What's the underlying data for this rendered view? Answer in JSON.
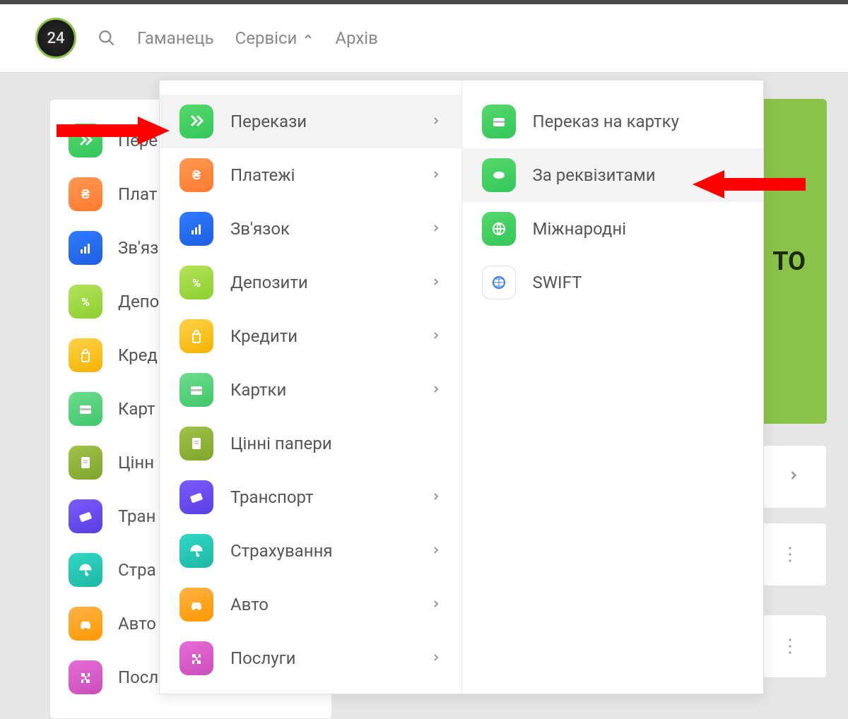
{
  "logo_text": "24",
  "header": {
    "nav_wallet": "Гаманець",
    "nav_services": "Сервіси",
    "nav_archive": "Архів"
  },
  "bg_sidebar": [
    "Пере",
    "Плат",
    "Зв'яз",
    "Депо",
    "Кред",
    "Карт",
    "Цінн",
    "Тран",
    "Стра",
    "Авто",
    "Посл"
  ],
  "bg_green_text": "ТО",
  "menu_left": [
    {
      "label": "Перекази",
      "icon": "chevrons",
      "color": "ic-green",
      "active": true,
      "chev": true
    },
    {
      "label": "Платежі",
      "icon": "uah",
      "color": "ic-orange",
      "active": false,
      "chev": true
    },
    {
      "label": "Зв'язок",
      "icon": "bars",
      "color": "ic-blue",
      "active": false,
      "chev": true
    },
    {
      "label": "Депозити",
      "icon": "percent",
      "color": "ic-lime",
      "active": false,
      "chev": true
    },
    {
      "label": "Кредити",
      "icon": "bag",
      "color": "ic-yellow",
      "active": false,
      "chev": true
    },
    {
      "label": "Картки",
      "icon": "card",
      "color": "ic-mint",
      "active": false,
      "chev": true
    },
    {
      "label": "Цінні папери",
      "icon": "doc",
      "color": "ic-olive",
      "active": false,
      "chev": false
    },
    {
      "label": "Транспорт",
      "icon": "ticket",
      "color": "ic-purple",
      "active": false,
      "chev": true
    },
    {
      "label": "Страхування",
      "icon": "umbrella",
      "color": "ic-teal",
      "active": false,
      "chev": true
    },
    {
      "label": "Авто",
      "icon": "car",
      "color": "ic-amber",
      "active": false,
      "chev": true
    },
    {
      "label": "Послуги",
      "icon": "puzzle",
      "color": "ic-pink",
      "active": false,
      "chev": true
    }
  ],
  "menu_right": [
    {
      "label": "Переказ на картку",
      "icon": "card",
      "color": "ic-green",
      "active": false
    },
    {
      "label": "За реквізитами",
      "icon": "map",
      "color": "ic-green",
      "active": true
    },
    {
      "label": "Міжнародні",
      "icon": "globe",
      "color": "ic-green",
      "active": false
    },
    {
      "label": "SWIFT",
      "icon": "swift",
      "color": "ic-white",
      "active": false
    }
  ],
  "bg_icon_colors": [
    "ic-green",
    "ic-orange",
    "ic-blue",
    "ic-lime",
    "ic-yellow",
    "ic-mint",
    "ic-olive",
    "ic-purple",
    "ic-teal",
    "ic-amber",
    "ic-pink"
  ]
}
